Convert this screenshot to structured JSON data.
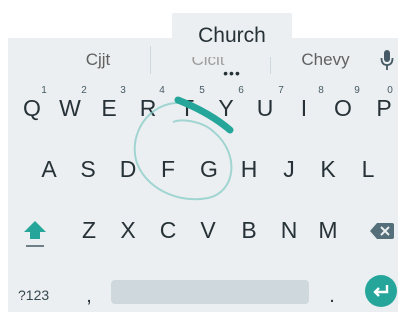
{
  "popup": {
    "word": "Church",
    "more": "•••"
  },
  "suggestions": {
    "left": "Cjjt",
    "middle": "Clclt",
    "right": "Chevy"
  },
  "keyboard": {
    "row1": [
      {
        "label": "Q",
        "hint": "1"
      },
      {
        "label": "W",
        "hint": "2"
      },
      {
        "label": "E",
        "hint": "3"
      },
      {
        "label": "R",
        "hint": "4"
      },
      {
        "label": "T",
        "hint": "5"
      },
      {
        "label": "Y",
        "hint": "6"
      },
      {
        "label": "U",
        "hint": "7"
      },
      {
        "label": "I",
        "hint": "8"
      },
      {
        "label": "O",
        "hint": "9"
      },
      {
        "label": "P",
        "hint": "0"
      }
    ],
    "row2": [
      "A",
      "S",
      "D",
      "F",
      "G",
      "H",
      "J",
      "K",
      "L"
    ],
    "row3": [
      "Z",
      "X",
      "C",
      "V",
      "B",
      "N",
      "M"
    ],
    "symbols_label": "?123",
    "comma": ",",
    "period": "."
  },
  "icons": {
    "mic": "microphone-icon",
    "shift": "shift-arrow-icon",
    "backspace": "backspace-icon",
    "enter": "enter-return-icon"
  },
  "colors": {
    "accent": "#26a69a",
    "gesture_trail": "#4db6ac",
    "keyboard_background": "#eceff1",
    "key_text": "#263238"
  }
}
